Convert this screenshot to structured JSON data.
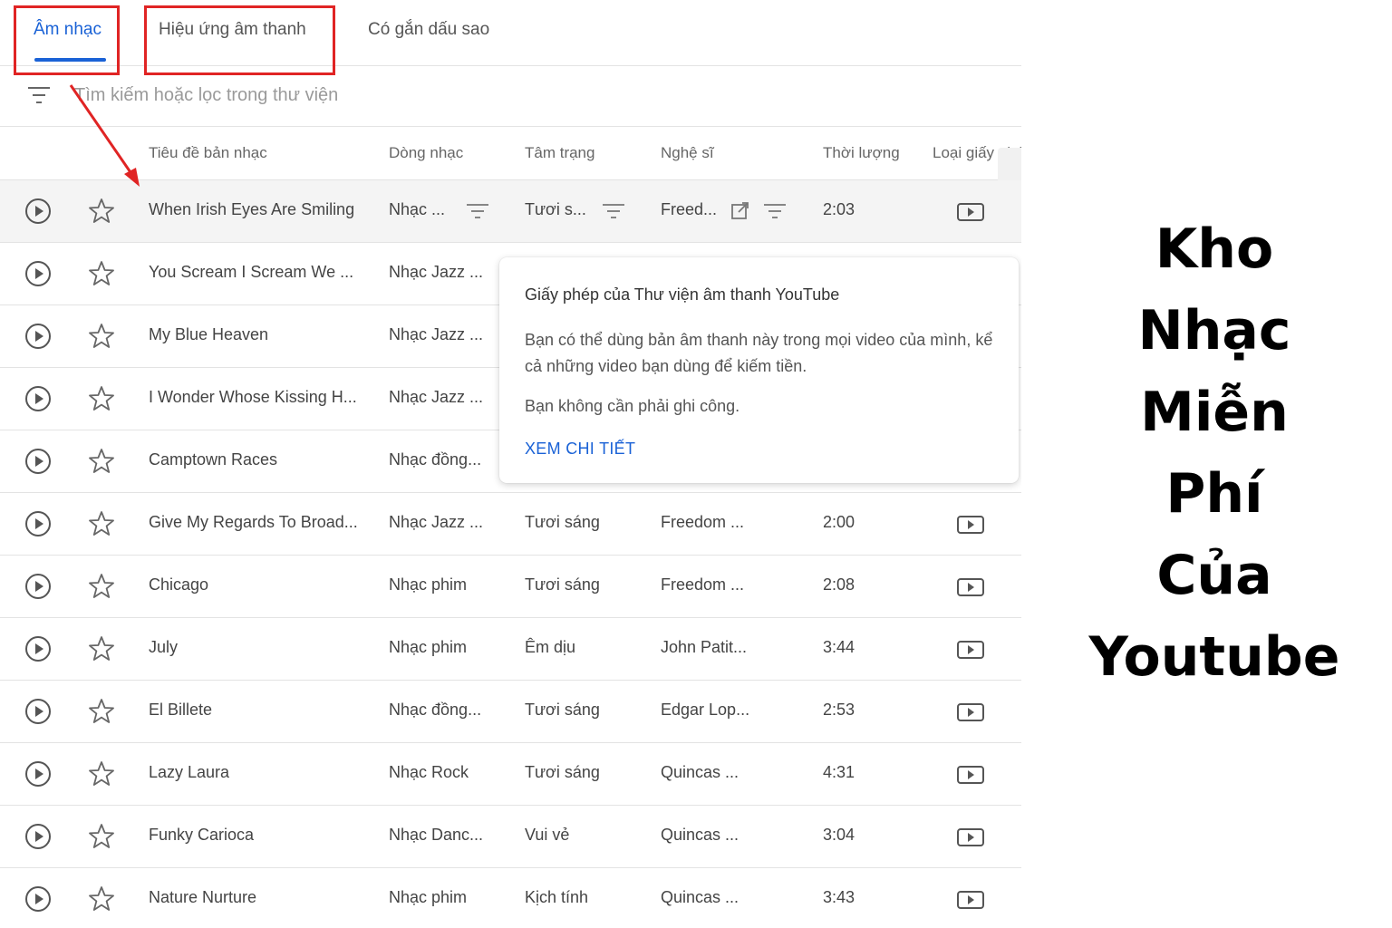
{
  "tabs": [
    {
      "label": "Âm nhạc",
      "active": true
    },
    {
      "label": "Hiệu ứng âm thanh",
      "active": false
    },
    {
      "label": "Có gắn dấu sao",
      "active": false
    }
  ],
  "search": {
    "placeholder": "Tìm kiếm hoặc lọc trong thư viện"
  },
  "columns": [
    "Tiêu đề bản nhạc",
    "Dòng nhạc",
    "Tâm trạng",
    "Nghệ sĩ",
    "Thời lượng",
    "Loại giấy phép"
  ],
  "rows": [
    {
      "title": "When Irish Eyes Are Smiling",
      "genre": "Nhạc ...",
      "mood": "Tươi s...",
      "artist": "Freed...",
      "duration": "2:03"
    },
    {
      "title": "You Scream I Scream We ...",
      "genre": "Nhạc Jazz ...",
      "mood": "",
      "artist": "",
      "duration": ""
    },
    {
      "title": "My Blue Heaven",
      "genre": "Nhạc Jazz ...",
      "mood": "",
      "artist": "",
      "duration": ""
    },
    {
      "title": "I Wonder Whose Kissing H...",
      "genre": "Nhạc Jazz ...",
      "mood": "",
      "artist": "",
      "duration": ""
    },
    {
      "title": "Camptown Races",
      "genre": "Nhạc đồng...",
      "mood": "",
      "artist": "",
      "duration": ""
    },
    {
      "title": "Give My Regards To Broad...",
      "genre": "Nhạc Jazz ...",
      "mood": "Tươi sáng",
      "artist": "Freedom ...",
      "duration": "2:00"
    },
    {
      "title": "Chicago",
      "genre": "Nhạc phim",
      "mood": "Tươi sáng",
      "artist": "Freedom ...",
      "duration": "2:08"
    },
    {
      "title": "July",
      "genre": "Nhạc phim",
      "mood": "Êm dịu",
      "artist": "John Patit...",
      "duration": "3:44"
    },
    {
      "title": "El Billete",
      "genre": "Nhạc đồng...",
      "mood": "Tươi sáng",
      "artist": "Edgar Lop...",
      "duration": "2:53"
    },
    {
      "title": "Lazy Laura",
      "genre": "Nhạc Rock",
      "mood": "Tươi sáng",
      "artist": "Quincas ...",
      "duration": "4:31"
    },
    {
      "title": "Funky Carioca",
      "genre": "Nhạc Danc...",
      "mood": "Vui vẻ",
      "artist": "Quincas ...",
      "duration": "3:04"
    },
    {
      "title": "Nature Nurture",
      "genre": "Nhạc phim",
      "mood": "Kịch tính",
      "artist": "Quincas ...",
      "duration": "3:43"
    }
  ],
  "popover": {
    "title": "Giấy phép của Thư viện âm thanh YouTube",
    "body1": "Bạn có thể dùng bản âm thanh này trong mọi video của mình, kể cả những video bạn dùng để kiếm tiền.",
    "body2": "Bạn không cần phải ghi công.",
    "link": "XEM CHI TIẾT"
  },
  "caption": [
    "Kho",
    "Nhạc",
    "Miễn",
    "Phí",
    "Của",
    "Youtube"
  ],
  "colors": {
    "accent": "#1a62d6",
    "highlight": "#e02424"
  },
  "icons": [
    "filter-icon",
    "play-icon",
    "star-icon",
    "external-link-icon",
    "license-youtube-icon"
  ]
}
